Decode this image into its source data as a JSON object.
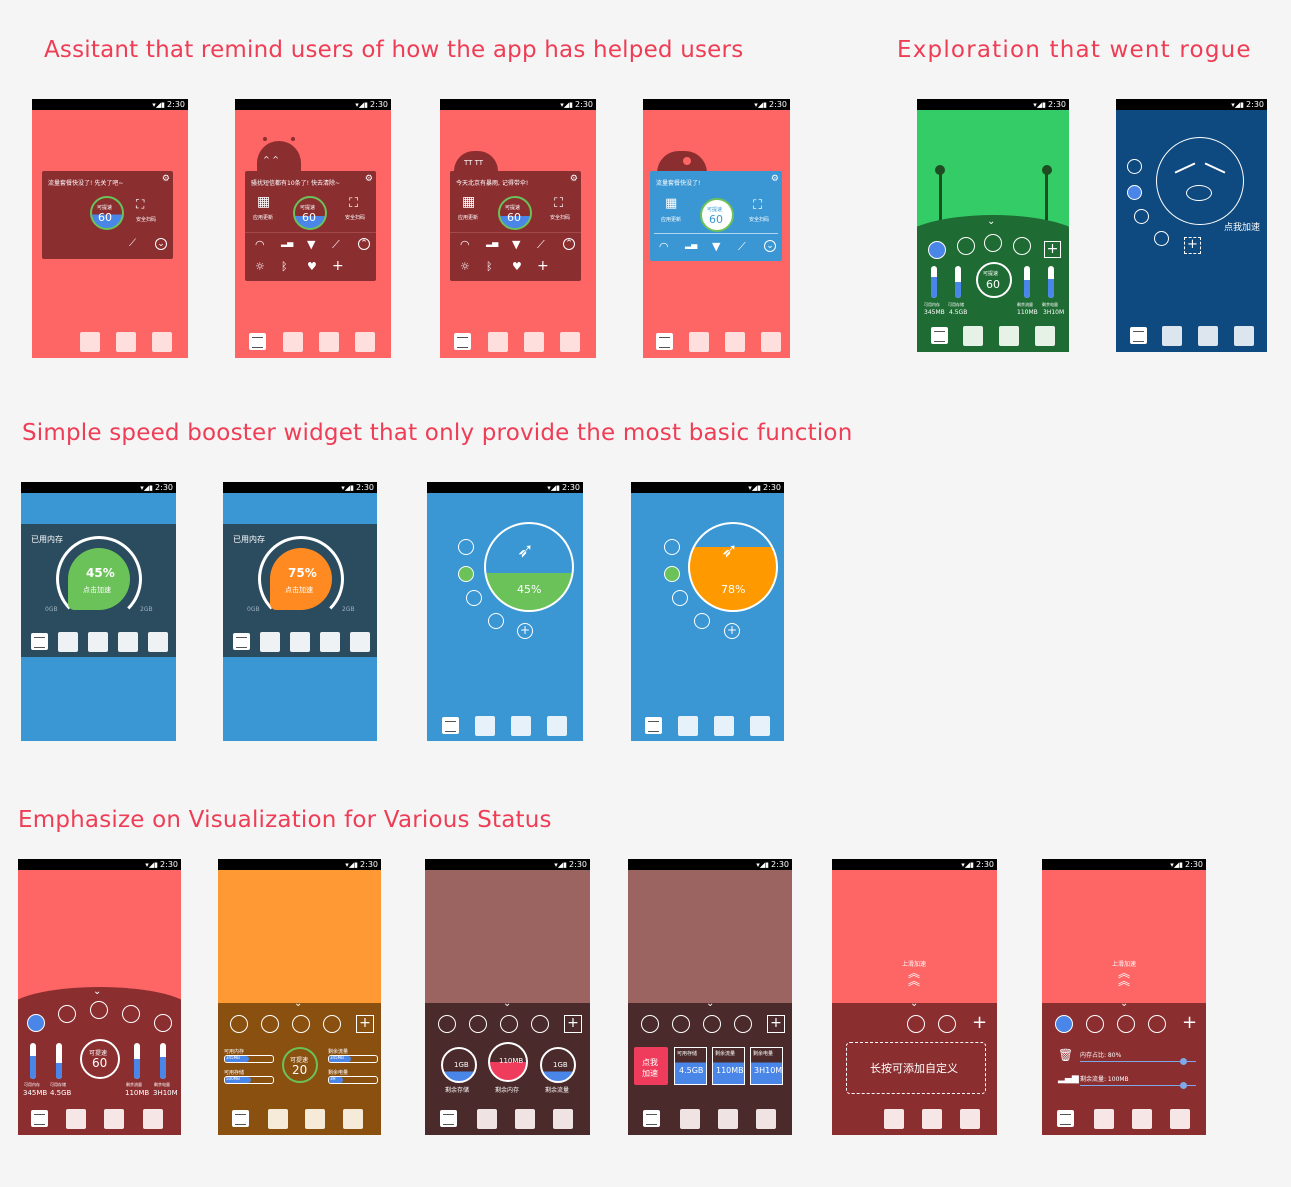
{
  "headings": {
    "assistant": "Assitant that remind users of how the app has helped users",
    "rogue": "Exploration that went rogue",
    "simple": "Simple speed booster widget that only provide the most basic function",
    "visual": "Emphasize on Visualization for Various Status"
  },
  "status_time": "2:30",
  "assistant": {
    "msg1": "流量套餐快没了! 先关了吧~",
    "msg2": "骚扰短信都有10条了! 快去清除~",
    "msg3": "今天北京有暴雨, 记得带伞!",
    "msg4": "流量套餐快没了!",
    "speed_label": "可提速",
    "speed_value": "60",
    "percent": "%",
    "app_update": "应用更新",
    "security_scan": "安全扫码"
  },
  "rogue": {
    "speed_label": "可提速",
    "speed_value": "60",
    "labels": [
      "可用内存",
      "可用存储",
      "剩余流量",
      "剩余电量"
    ],
    "values": [
      "345MB",
      "4.5GB",
      "110MB",
      "3H10M"
    ],
    "tap_boost": "点我加速"
  },
  "simple": {
    "used_memory": "已用内存",
    "p1": "45%",
    "p2": "75%",
    "tap_boost": "点击加速",
    "min": "0GB",
    "max": "2GB",
    "p3": "45%",
    "p4": "78%"
  },
  "visual": {
    "speed_label": "可提速",
    "v1": "60",
    "v2": "20",
    "labels": [
      "可用内存",
      "可用存储",
      "剩余流量",
      "剩余电量"
    ],
    "values": [
      "345MB",
      "4.5GB",
      "110MB",
      "3H10M"
    ],
    "mem_avail": "可用内存",
    "storage_avail": "可用存储",
    "traffic_left": "剩余流量",
    "battery_left": "剩余电量",
    "s2_left": [
      "345MB",
      "500MB"
    ],
    "s2_right": [
      "345MB",
      "3H"
    ],
    "g1": "1GB",
    "g2": "110MB",
    "g3": "1GB",
    "g_labels": [
      "剩余存储",
      "剩余内存",
      "剩余流量"
    ],
    "tap_me": "点我",
    "accelerate": "加速",
    "tile_vals": [
      "4.5GB",
      "110MB",
      "3H10M"
    ],
    "swipe_up": "上滑加速",
    "long_press": "长按可添加自定义",
    "mem_ratio": "内存占比: 80%",
    "traffic": "剩余流量: 100MB"
  }
}
